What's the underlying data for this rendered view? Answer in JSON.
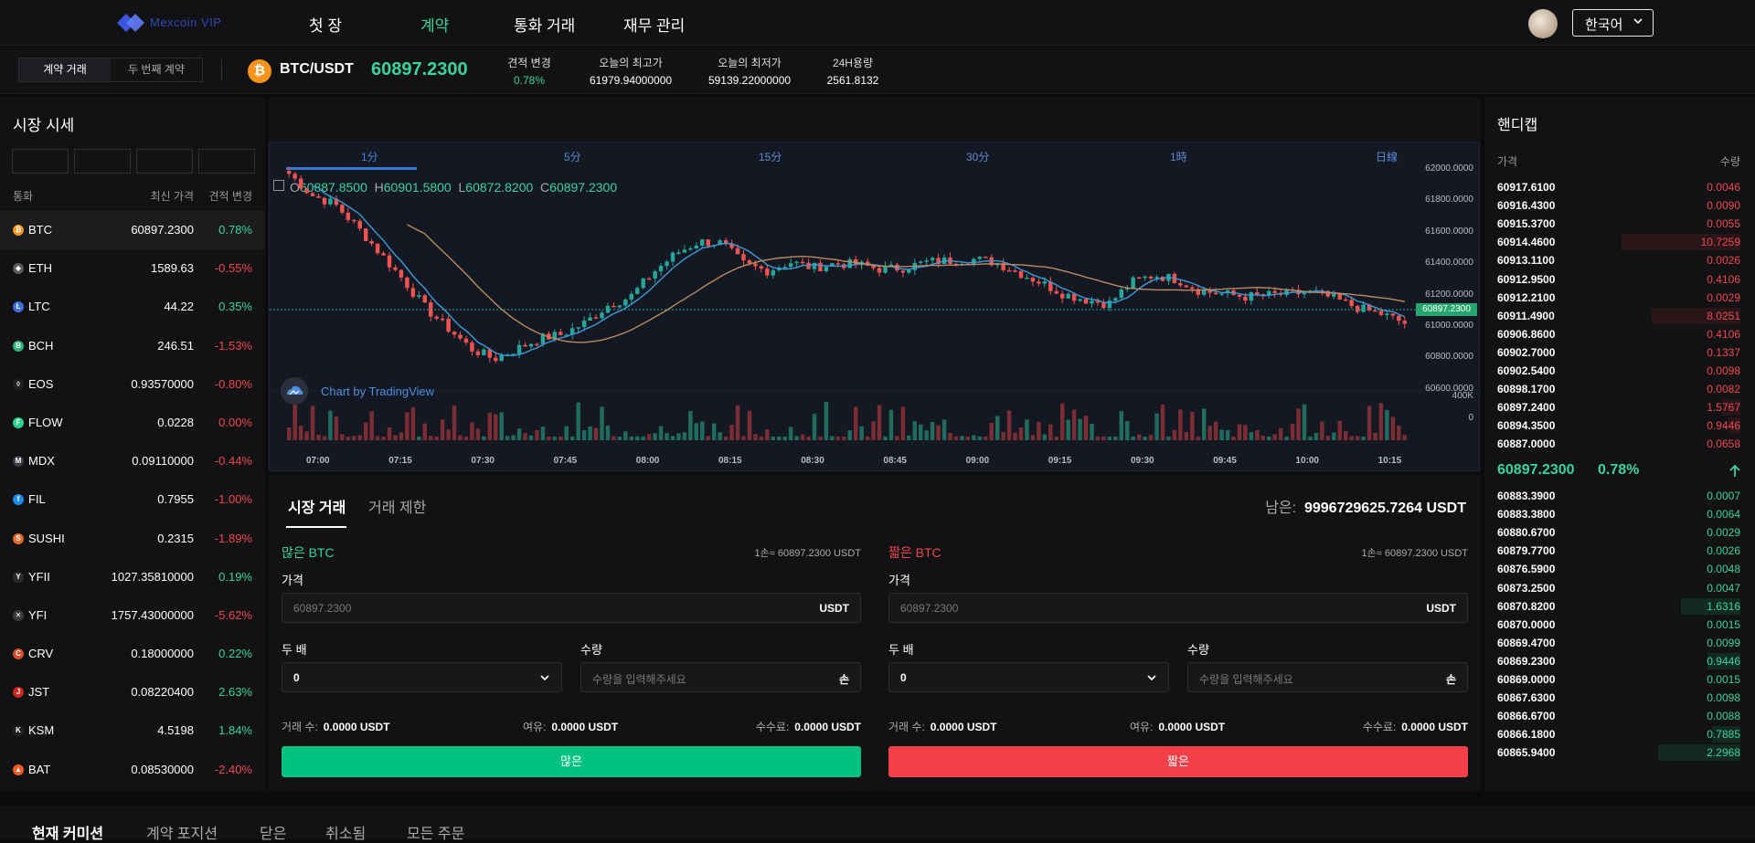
{
  "nav": {
    "logo_text": "Mexcoin VIP",
    "items": [
      "첫 장",
      "계약",
      "통화 거래",
      "재무 관리"
    ],
    "active_index": 1,
    "language": "한국어"
  },
  "ticker": {
    "tabs": [
      "계약 거래",
      "두 번째 계약"
    ],
    "coin_symbol": "₿",
    "pair": "BTC/USDT",
    "price": "60897.2300",
    "stats": [
      {
        "label": "견적 변경",
        "value": "0.78%"
      },
      {
        "label": "오늘의 최고가",
        "value": "61979.94000000"
      },
      {
        "label": "오늘의 최저가",
        "value": "59139.22000000"
      },
      {
        "label": "24H용량",
        "value": "2561.8132"
      }
    ]
  },
  "market": {
    "title": "시장 시세",
    "headers": {
      "coin": "통화",
      "price": "최신 가격",
      "change": "견적 변경"
    },
    "rows": [
      {
        "sym": "BTC",
        "price": "60897.2300",
        "change": "0.78%",
        "dir": "up",
        "color": "#f7931a",
        "glyph": "₿"
      },
      {
        "sym": "ETH",
        "price": "1589.63",
        "change": "-0.55%",
        "dir": "down",
        "color": "#5a5a5a",
        "glyph": "◆"
      },
      {
        "sym": "LTC",
        "price": "44.22",
        "change": "0.35%",
        "dir": "up",
        "color": "#3a6fd8",
        "glyph": "Ł"
      },
      {
        "sym": "BCH",
        "price": "246.51",
        "change": "-1.53%",
        "dir": "down",
        "color": "#2db37a",
        "glyph": "B"
      },
      {
        "sym": "EOS",
        "price": "0.93570000",
        "change": "-0.80%",
        "dir": "down",
        "color": "#202020",
        "glyph": "◊"
      },
      {
        "sym": "FLOW",
        "price": "0.0228",
        "change": "0.00%",
        "dir": "down",
        "color": "#2cd38b",
        "glyph": "F"
      },
      {
        "sym": "MDX",
        "price": "0.09110000",
        "change": "-0.44%",
        "dir": "down",
        "color": "#3d3d48",
        "glyph": "M"
      },
      {
        "sym": "FIL",
        "price": "0.7955",
        "change": "-1.00%",
        "dir": "down",
        "color": "#1e8ce8",
        "glyph": "f"
      },
      {
        "sym": "SUSHI",
        "price": "0.2315",
        "change": "-1.89%",
        "dir": "down",
        "color": "#e06a2a",
        "glyph": "S"
      },
      {
        "sym": "YFII",
        "price": "1027.35810000",
        "change": "0.19%",
        "dir": "up",
        "color": "#2a2a2a",
        "glyph": "Y"
      },
      {
        "sym": "YFI",
        "price": "1757.43000000",
        "change": "-5.62%",
        "dir": "down",
        "color": "#3a3a3a",
        "glyph": "✕"
      },
      {
        "sym": "CRV",
        "price": "0.18000000",
        "change": "0.22%",
        "dir": "up",
        "color": "#d24d2a",
        "glyph": "C"
      },
      {
        "sym": "JST",
        "price": "0.08220400",
        "change": "2.63%",
        "dir": "up",
        "color": "#c8281e",
        "glyph": "J"
      },
      {
        "sym": "KSM",
        "price": "4.5198",
        "change": "1.84%",
        "dir": "up",
        "color": "#1f1f1f",
        "glyph": "K"
      },
      {
        "sym": "BAT",
        "price": "0.08530000",
        "change": "-2.40%",
        "dir": "down",
        "color": "#f05a24",
        "glyph": "▲"
      }
    ]
  },
  "chart": {
    "intervals": [
      "1分",
      "5分",
      "15分",
      "30分",
      "1時",
      "日線"
    ],
    "active_interval": 0,
    "ohlc": {
      "o": "60887.8500",
      "h": "60901.5800",
      "l": "60872.8200",
      "c": "60897.2300"
    },
    "watermark": "Chart by TradingView",
    "current_label": "60897.2300"
  },
  "chart_data": {
    "type": "candlestick",
    "y_ticks": [
      "62000.0000",
      "61800.0000",
      "61600.0000",
      "61400.0000",
      "61200.0000",
      "61000.0000",
      "60800.0000",
      "60600.0000"
    ],
    "volume_ticks": [
      "400K",
      "0"
    ],
    "x_ticks": [
      "07:00",
      "07:15",
      "07:30",
      "07:45",
      "08:00",
      "08:15",
      "08:30",
      "08:45",
      "09:00",
      "09:15",
      "09:30",
      "09:45",
      "10:00",
      "10:15"
    ],
    "ylim": [
      60480,
      62000
    ],
    "series": [
      {
        "name": "close",
        "points": [
          {
            "t": "07:00",
            "v": 61930
          },
          {
            "t": "07:04",
            "v": 61780
          },
          {
            "t": "07:08",
            "v": 61720
          },
          {
            "t": "07:12",
            "v": 61560
          },
          {
            "t": "07:15",
            "v": 61380
          },
          {
            "t": "07:19",
            "v": 61200
          },
          {
            "t": "07:23",
            "v": 61000
          },
          {
            "t": "07:27",
            "v": 60860
          },
          {
            "t": "07:31",
            "v": 60720
          },
          {
            "t": "07:35",
            "v": 60650
          },
          {
            "t": "07:39",
            "v": 60720
          },
          {
            "t": "07:43",
            "v": 60790
          },
          {
            "t": "07:47",
            "v": 60820
          },
          {
            "t": "07:51",
            "v": 60900
          },
          {
            "t": "07:55",
            "v": 61020
          },
          {
            "t": "08:00",
            "v": 61080
          },
          {
            "t": "08:04",
            "v": 61250
          },
          {
            "t": "08:08",
            "v": 61380
          },
          {
            "t": "08:12",
            "v": 61460
          },
          {
            "t": "08:15",
            "v": 61450
          },
          {
            "t": "08:19",
            "v": 61300
          },
          {
            "t": "08:23",
            "v": 61260
          },
          {
            "t": "08:27",
            "v": 61320
          },
          {
            "t": "08:31",
            "v": 61280
          },
          {
            "t": "08:35",
            "v": 61310
          },
          {
            "t": "08:39",
            "v": 61300
          },
          {
            "t": "08:43",
            "v": 61270
          },
          {
            "t": "08:47",
            "v": 61280
          },
          {
            "t": "08:51",
            "v": 61320
          },
          {
            "t": "08:55",
            "v": 61330
          },
          {
            "t": "09:00",
            "v": 61340
          },
          {
            "t": "09:04",
            "v": 61320
          },
          {
            "t": "09:08",
            "v": 61250
          },
          {
            "t": "09:12",
            "v": 61180
          },
          {
            "t": "09:15",
            "v": 61100
          },
          {
            "t": "09:19",
            "v": 61060
          },
          {
            "t": "09:23",
            "v": 61030
          },
          {
            "t": "09:27",
            "v": 61180
          },
          {
            "t": "09:31",
            "v": 61230
          },
          {
            "t": "09:35",
            "v": 61200
          },
          {
            "t": "09:39",
            "v": 61120
          },
          {
            "t": "09:43",
            "v": 61100
          },
          {
            "t": "09:47",
            "v": 61080
          },
          {
            "t": "09:51",
            "v": 61090
          },
          {
            "t": "09:55",
            "v": 61100
          },
          {
            "t": "10:00",
            "v": 61110
          },
          {
            "t": "10:04",
            "v": 61060
          },
          {
            "t": "10:08",
            "v": 61000
          },
          {
            "t": "10:12",
            "v": 60960
          },
          {
            "t": "10:15",
            "v": 60897
          }
        ]
      }
    ]
  },
  "trade": {
    "tabs": [
      "시장 거래",
      "거래 제한"
    ],
    "balance_label": "남은:",
    "balance_value": "9996729625.7264 USDT",
    "long": {
      "title": "많은 BTC",
      "rate": "1손≈ 60897.2300 USDT",
      "price_label": "가격",
      "price_placeholder": "60897.2300",
      "price_suffix": "USDT",
      "lev_label": "두 배",
      "lev_value": "0",
      "qty_label": "수량",
      "qty_placeholder": "수량을 입력해주세요",
      "qty_suffix": "손",
      "info": [
        {
          "l": "거래 수:",
          "v": "0.0000 USDT"
        },
        {
          "l": "여유:",
          "v": "0.0000 USDT"
        },
        {
          "l": "수수료:",
          "v": "0.0000 USDT"
        }
      ],
      "button": "많은",
      "color": "#00c382"
    },
    "short": {
      "title": "짧은 BTC",
      "rate": "1손≈ 60897.2300 USDT",
      "price_label": "가격",
      "price_placeholder": "60897.2300",
      "price_suffix": "USDT",
      "lev_label": "두 배",
      "lev_value": "0",
      "qty_label": "수량",
      "qty_placeholder": "수량을 입력해주세요",
      "qty_suffix": "손",
      "info": [
        {
          "l": "거래 수:",
          "v": "0.0000 USDT"
        },
        {
          "l": "여유:",
          "v": "0.0000 USDT"
        },
        {
          "l": "수수료:",
          "v": "0.0000 USDT"
        }
      ],
      "button": "짧은",
      "color": "#f5404a"
    }
  },
  "book": {
    "title": "핸디캡",
    "headers": {
      "price": "가격",
      "qty": "수량"
    },
    "asks": [
      {
        "p": "60917.6100",
        "q": "0.0046",
        "depth": 0
      },
      {
        "p": "60916.4300",
        "q": "0.0090",
        "depth": 0
      },
      {
        "p": "60915.3700",
        "q": "0.0055",
        "depth": 0
      },
      {
        "p": "60914.4600",
        "q": "10.7259",
        "depth": 0.72
      },
      {
        "p": "60913.1100",
        "q": "0.0026",
        "depth": 0
      },
      {
        "p": "60912.9500",
        "q": "0.4106",
        "depth": 0
      },
      {
        "p": "60912.2100",
        "q": "0.0029",
        "depth": 0
      },
      {
        "p": "60911.4900",
        "q": "8.0251",
        "depth": 0.54
      },
      {
        "p": "60906.8600",
        "q": "0.4106",
        "depth": 0
      },
      {
        "p": "60902.7000",
        "q": "0.1337",
        "depth": 0
      },
      {
        "p": "60902.5400",
        "q": "0.0098",
        "depth": 0
      },
      {
        "p": "60898.1700",
        "q": "0.0082",
        "depth": 0
      },
      {
        "p": "60897.2400",
        "q": "1.5767",
        "depth": 0.11
      },
      {
        "p": "60894.3500",
        "q": "0.9446",
        "depth": 0.07
      },
      {
        "p": "60887.0000",
        "q": "0.0658",
        "depth": 0
      }
    ],
    "mid_price": "60897.2300",
    "mid_change": "0.78%",
    "bids": [
      {
        "p": "60883.3900",
        "q": "0.0007",
        "depth": 0
      },
      {
        "p": "60883.3800",
        "q": "0.0064",
        "depth": 0
      },
      {
        "p": "60880.6700",
        "q": "0.0029",
        "depth": 0
      },
      {
        "p": "60879.7700",
        "q": "0.0026",
        "depth": 0
      },
      {
        "p": "60876.5900",
        "q": "0.0048",
        "depth": 0
      },
      {
        "p": "60873.2500",
        "q": "0.0047",
        "depth": 0
      },
      {
        "p": "60870.8200",
        "q": "1.6316",
        "depth": 0.36
      },
      {
        "p": "60870.0000",
        "q": "0.0015",
        "depth": 0
      },
      {
        "p": "60869.4700",
        "q": "0.0099",
        "depth": 0
      },
      {
        "p": "60869.2300",
        "q": "0.9446",
        "depth": 0.2
      },
      {
        "p": "60869.0000",
        "q": "0.0015",
        "depth": 0
      },
      {
        "p": "60867.6300",
        "q": "0.0098",
        "depth": 0
      },
      {
        "p": "60866.6700",
        "q": "0.0088",
        "depth": 0
      },
      {
        "p": "60866.1800",
        "q": "0.7885",
        "depth": 0.17
      },
      {
        "p": "60865.9400",
        "q": "2.2968",
        "depth": 0.5
      }
    ]
  },
  "bottom_tabs": [
    "현재 커미션",
    "계약 포지션",
    "닫은",
    "취소됨",
    "모든 주문"
  ],
  "colors": {
    "up": "#38d39f",
    "down": "#f0474f",
    "accent": "#3679d2"
  }
}
